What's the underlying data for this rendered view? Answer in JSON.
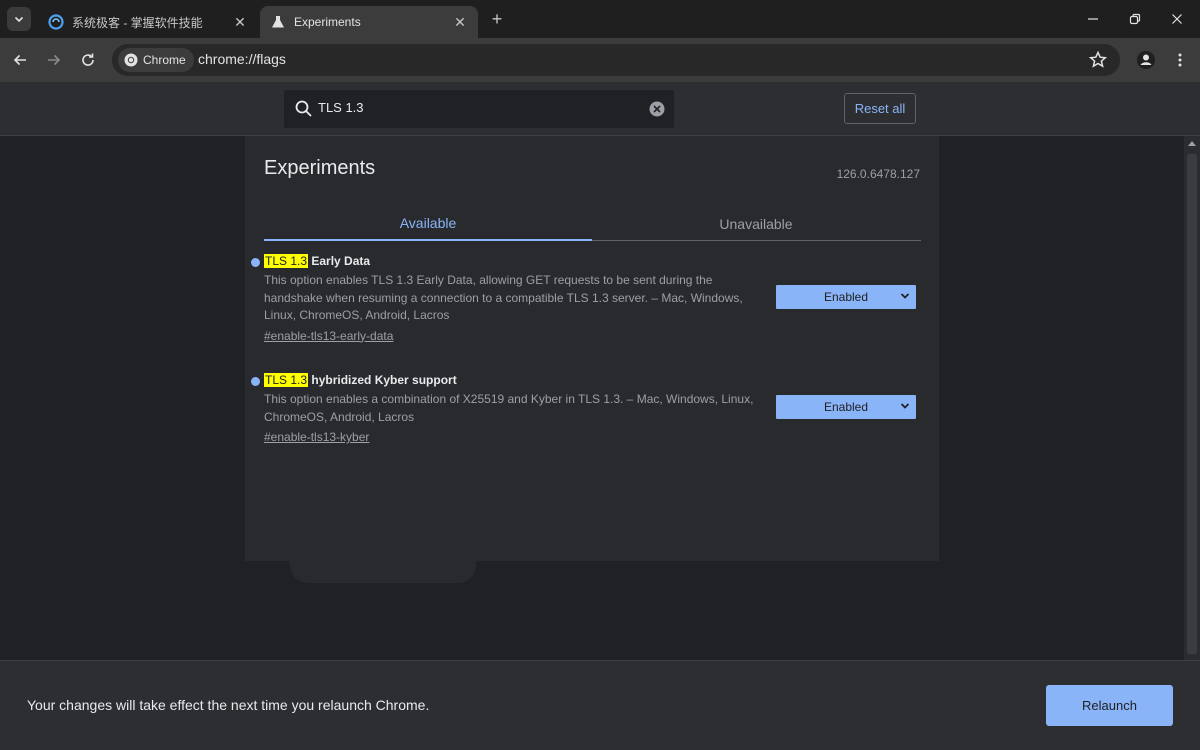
{
  "tabs": [
    {
      "title": "系统极客 - 掌握软件技能",
      "active": false,
      "favicon": "system-geek-icon"
    },
    {
      "title": "Experiments",
      "active": true,
      "favicon": "flask-icon"
    }
  ],
  "toolbar": {
    "chip_label": "Chrome",
    "url": "chrome://flags"
  },
  "search": {
    "value": "TLS 1.3",
    "reset_label": "Reset all"
  },
  "page": {
    "title": "Experiments",
    "version": "126.0.6478.127",
    "tab_available": "Available",
    "tab_unavailable": "Unavailable"
  },
  "experiments": [
    {
      "highlight": "TLS 1.3",
      "name_rest": " Early Data",
      "description": "This option enables TLS 1.3 Early Data, allowing GET requests to be sent during the handshake when resuming a connection to a compatible TLS 1.3 server. – Mac, Windows, Linux, ChromeOS, Android, Lacros",
      "link": "#enable-tls13-early-data",
      "state": "Enabled"
    },
    {
      "highlight": "TLS 1.3",
      "name_rest": " hybridized Kyber support",
      "description": "This option enables a combination of X25519 and Kyber in TLS 1.3. – Mac, Windows, Linux, ChromeOS, Android, Lacros",
      "link": "#enable-tls13-kyber",
      "state": "Enabled"
    }
  ],
  "footer": {
    "message": "Your changes will take effect the next time you relaunch Chrome.",
    "relaunch_label": "Relaunch"
  },
  "colors": {
    "accent": "#8ab4f8",
    "highlight": "#ffff00",
    "background": "#202124",
    "panel": "#292a2d"
  }
}
